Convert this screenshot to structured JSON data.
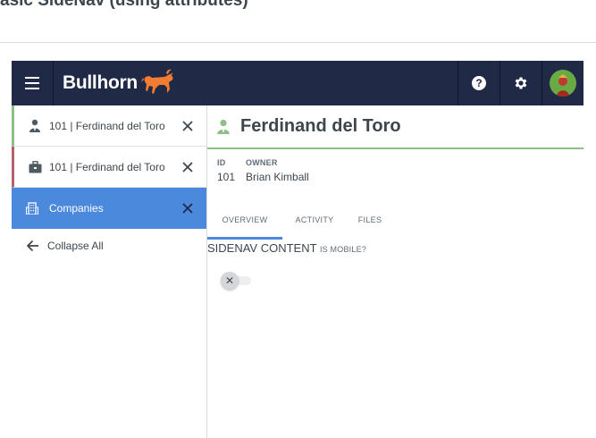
{
  "page": {
    "title": "asic SideNav (using attributes)"
  },
  "header": {
    "brand": "Bullhorn",
    "help_glyph": "?"
  },
  "colors": {
    "header_bg": "#202945",
    "active_blue": "#4a89dc",
    "candidate_green": "#8cc084",
    "job_red": "#b5616d",
    "bull_orange": "#f37c33"
  },
  "sidenav": {
    "items": [
      {
        "label": "101 | Ferdinand del Toro",
        "icon": "candidate-icon",
        "accent": "green"
      },
      {
        "label": "101 | Ferdinand del Toro",
        "icon": "job-briefcase-icon",
        "accent": "red"
      },
      {
        "label": "Companies",
        "icon": "company-building-icon",
        "active": true
      }
    ],
    "collapse_label": "Collapse All"
  },
  "record": {
    "name": "Ferdinand del Toro",
    "id_label": "ID",
    "id_value": "101",
    "owner_label": "OWNER",
    "owner_value": "Brian Kimball"
  },
  "tabs": [
    {
      "label": "OVERVIEW",
      "active": true
    },
    {
      "label": "ACTIVITY"
    },
    {
      "label": "FILES"
    }
  ],
  "content": {
    "heading": "SIDENAV CONTENT",
    "subheading": "IS MOBILE?",
    "toggle_glyph": "✕",
    "is_mobile": false
  }
}
